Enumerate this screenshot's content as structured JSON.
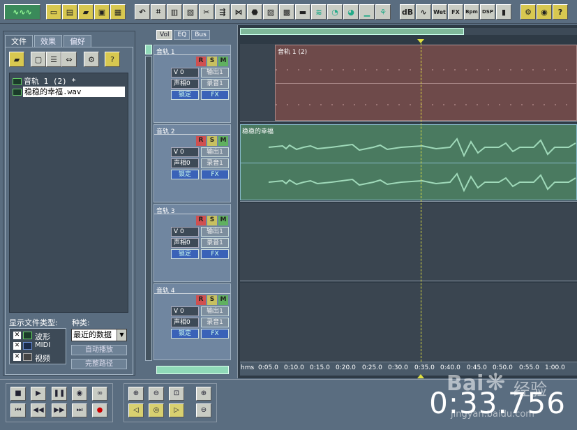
{
  "toolbar": {
    "icons": [
      "logo",
      "new-file",
      "open-file",
      "open-folder",
      "save",
      "save-all",
      "undo",
      "crop",
      "fit",
      "zoom-in-toolbar",
      "cut",
      "trim",
      "silence",
      "fade",
      "envelope",
      "insert",
      "stretch",
      "noise",
      "normalize",
      "pan",
      "db-meter",
      "vu",
      "wet",
      "fx",
      "bpm",
      "dsp",
      "mixer",
      "help"
    ],
    "labels": {
      "wet": "Wet",
      "fx": "FX",
      "bpm": "Bpm",
      "dsp": "DSP"
    }
  },
  "left_panel": {
    "tabs": [
      "文件",
      "效果",
      "偏好"
    ],
    "files": [
      {
        "name": "音轨  1 (2) *",
        "selected": false
      },
      {
        "name": "稳稳的幸福.wav",
        "selected": true
      }
    ],
    "show_types_label": "显示文件类型:",
    "types": [
      {
        "label": "波形",
        "checked": true
      },
      {
        "label": "MIDI",
        "checked": true
      },
      {
        "label": "视频",
        "checked": true
      }
    ],
    "kind_label": "种类:",
    "kind_value": "最近的数据",
    "auto_play": "自动播放",
    "full_path": "完整路径"
  },
  "mixer_tabs": [
    "Vol",
    "EQ",
    "Bus"
  ],
  "tracks": [
    {
      "name": "音轨 1",
      "vol": "V 0",
      "pan": "声相0",
      "out": "输出1",
      "rec": "录音1",
      "lock": "锁定",
      "fx": "FX"
    },
    {
      "name": "音轨 2",
      "vol": "V 0",
      "pan": "声相0",
      "out": "输出1",
      "rec": "录音1",
      "lock": "锁定",
      "fx": "FX"
    },
    {
      "name": "音轨 3",
      "vol": "V 0",
      "pan": "声相0",
      "out": "输出1",
      "rec": "录音1",
      "lock": "锁定",
      "fx": "FX"
    },
    {
      "name": "音轨 4",
      "vol": "V 0",
      "pan": "声相0",
      "out": "输出1",
      "rec": "录音1",
      "lock": "锁定",
      "fx": "FX"
    }
  ],
  "rsm": [
    "R",
    "S",
    "M"
  ],
  "clips": [
    {
      "label": "音轨  1 (2)",
      "color": "#6e4a4a"
    },
    {
      "label": "稳稳的幸福",
      "color": "#4a7a60"
    }
  ],
  "ruler": {
    "unit": "hms",
    "ticks": [
      "0:05.0",
      "0:10.0",
      "0:15.0",
      "0:20.0",
      "0:25.0",
      "0:30.0",
      "0:35.0",
      "0:40.0",
      "0:45.0",
      "0:50.0",
      "0:55.0",
      "1:00.0"
    ]
  },
  "time_display": "0:33.756",
  "watermark": {
    "brand": "Bai",
    "suffix": "经验",
    "url": "jingyan.baidu.com"
  },
  "transport": [
    "stop",
    "play",
    "pause",
    "play-to-end",
    "loop",
    "go-start",
    "rewind",
    "fast-forward",
    "go-end",
    "record"
  ],
  "zoom": [
    "zoom-in-h",
    "zoom-out-h",
    "zoom-full",
    "zoom-in-v",
    "zoom-sel-left",
    "zoom-sel",
    "zoom-sel-right",
    "zoom-out-v"
  ],
  "colors": {
    "bg": "#5a6d80",
    "red_clip": "#6e4a4a",
    "green_clip": "#4a7a60",
    "cursor": "#e0e040"
  }
}
